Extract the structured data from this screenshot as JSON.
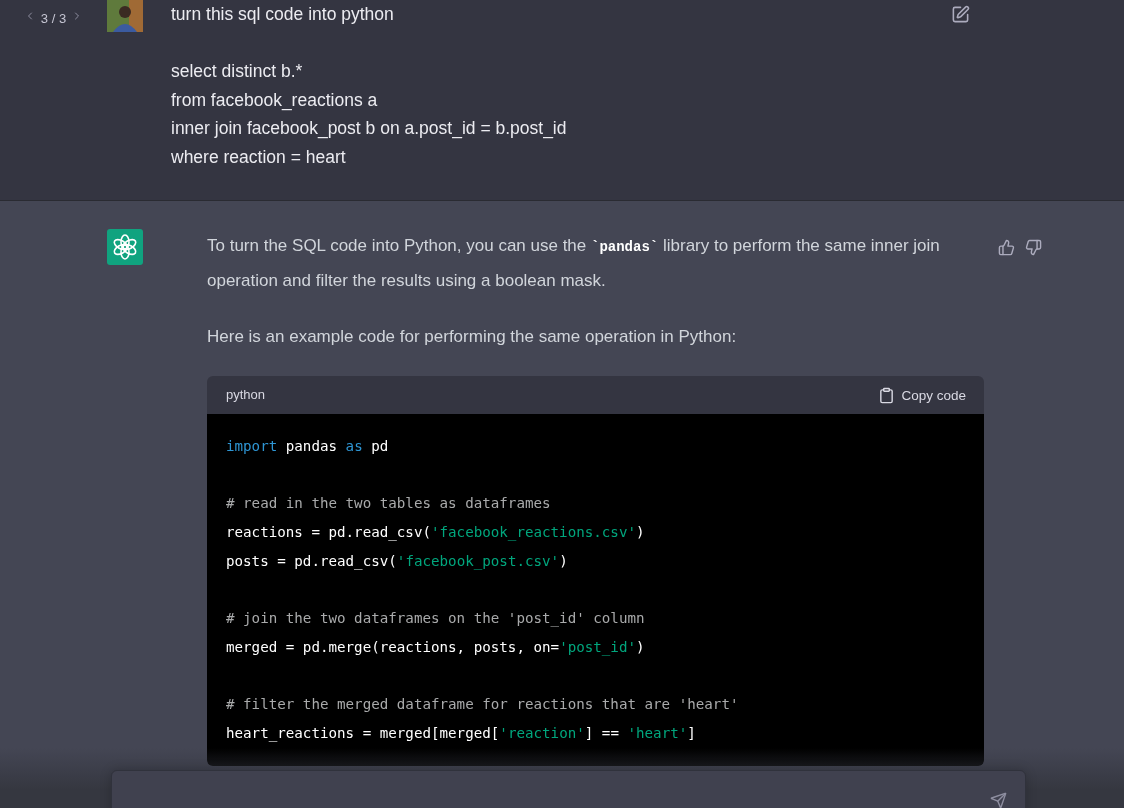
{
  "user_message": {
    "pager": "3 / 3",
    "paragraphs": [
      [
        "turn this sql code into python"
      ],
      [
        "select distinct b.*",
        "from facebook_reactions a",
        "inner join facebook_post b on a.post_id = b.post_id",
        "where reaction = heart"
      ]
    ]
  },
  "assistant_message": {
    "paragraphs": [
      "To turn the SQL code into Python, you can use the **`pandas`** library to perform the same inner join operation and filter the results using a boolean mask.",
      "Here is an example code for performing the same operation in Python:"
    ],
    "code_block": {
      "language": "python",
      "copy_label": "Copy code",
      "lines": [
        {
          "kind": "code",
          "tokens": [
            {
              "kind": "keyword",
              "text": "import"
            },
            {
              "kind": "plain",
              "text": " pandas "
            },
            {
              "kind": "keyword",
              "text": "as"
            },
            {
              "kind": "plain",
              "text": " pd"
            }
          ]
        },
        {
          "kind": "blank"
        },
        {
          "kind": "code",
          "tokens": [
            {
              "kind": "comment",
              "text": "# read in the two tables as dataframes"
            }
          ]
        },
        {
          "kind": "code",
          "tokens": [
            {
              "kind": "plain",
              "text": "reactions = pd.read_csv("
            },
            {
              "kind": "string",
              "text": "'facebook_reactions.csv'"
            },
            {
              "kind": "plain",
              "text": ")"
            }
          ]
        },
        {
          "kind": "code",
          "tokens": [
            {
              "kind": "plain",
              "text": "posts = pd.read_csv("
            },
            {
              "kind": "string",
              "text": "'facebook_post.csv'"
            },
            {
              "kind": "plain",
              "text": ")"
            }
          ]
        },
        {
          "kind": "blank"
        },
        {
          "kind": "code",
          "tokens": [
            {
              "kind": "comment",
              "text": "# join the two dataframes on the 'post_id' column"
            }
          ]
        },
        {
          "kind": "code",
          "tokens": [
            {
              "kind": "plain",
              "text": "merged = pd.merge(reactions, posts, on="
            },
            {
              "kind": "string",
              "text": "'post_id'"
            },
            {
              "kind": "plain",
              "text": ")"
            }
          ]
        },
        {
          "kind": "blank"
        },
        {
          "kind": "code",
          "tokens": [
            {
              "kind": "comment",
              "text": "# filter the merged dataframe for reactions that are 'heart'"
            }
          ]
        },
        {
          "kind": "code",
          "tokens": [
            {
              "kind": "plain",
              "text": "heart_reactions = merged[merged["
            },
            {
              "kind": "string",
              "text": "'reaction'"
            },
            {
              "kind": "plain",
              "text": "] == "
            },
            {
              "kind": "string",
              "text": "'heart'"
            },
            {
              "kind": "plain",
              "text": "]"
            }
          ]
        }
      ]
    }
  }
}
